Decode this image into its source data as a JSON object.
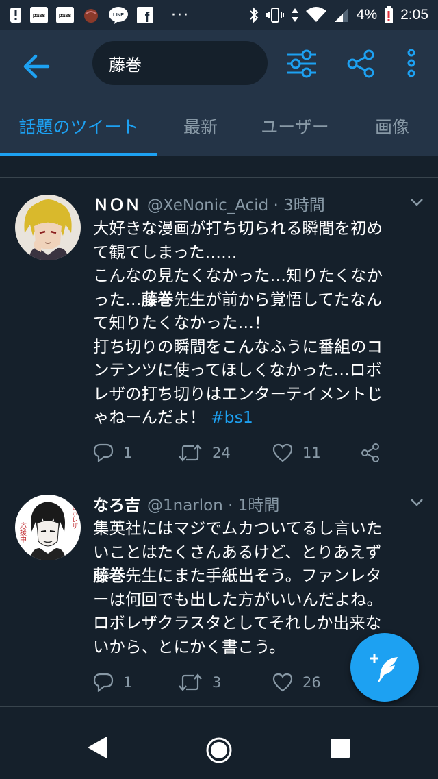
{
  "status_bar": {
    "pass_label": "pass",
    "line_label": "LINE",
    "facebook_label": "f",
    "overflow_dots": "···",
    "battery_percent": "4%",
    "time": "2:05"
  },
  "app_bar": {
    "search_query": "藤巻"
  },
  "tabs": [
    {
      "label": "話題のツイート",
      "active": true
    },
    {
      "label": "最新",
      "active": false
    },
    {
      "label": "ユーザー",
      "active": false
    },
    {
      "label": "画像",
      "active": false
    }
  ],
  "tweets": [
    {
      "name": "ＮＯＮ",
      "handle": "@XeNonic_Acid · 3時間",
      "text_lines": [
        "大好きな漫画が打ち切られる瞬間を初め",
        "て観てしまった……",
        "こんなの見たくなかった…知りたくなか",
        "った…",
        "藤巻",
        "先生が前から覚悟してたなん",
        "て知りたくなかった…！",
        "打ち切りの瞬間をこんなふうに番組のコ",
        "ンテンツに使ってほしくなかった…ロボ",
        "レザの打ち切りはエンターテイメントじ",
        "ゃねーんだよ！ ",
        "#bs1"
      ],
      "replies": "1",
      "retweets": "24",
      "likes": "11"
    },
    {
      "name": "なろ吉",
      "handle": "@1narlon · 1時間",
      "text_lines": [
        "集英社にはマジでムカついてるし言いた",
        "いことはたくさんあるけど、とりあえず",
        "藤巻",
        "先生にまた手紙出そう。ファンレタ",
        "ーは何回でも出した方がいいんだよね。",
        "ロボレザクラスタとしてそれしか出来な",
        "いから、とにかく書こう。"
      ],
      "replies": "1",
      "retweets": "3",
      "likes": "26"
    }
  ],
  "avatar_2_badge_left": "応援中",
  "avatar_2_badge_right": "ロボレザ",
  "colors": {
    "background": "#15202b",
    "header": "#243447",
    "accent": "#1da1f2",
    "secondary_text": "#8899a6",
    "divider": "#38444d"
  },
  "icons": [
    "alert-icon",
    "pass-icon",
    "pass-icon",
    "chestnut-icon",
    "line-icon",
    "facebook-icon",
    "bluetooth-icon",
    "vibrate-icon",
    "data-arrows-icon",
    "wifi-icon",
    "signal-icon",
    "battery-low-icon",
    "back-arrow-icon",
    "filter-sliders-icon",
    "share-icon",
    "more-vertical-icon",
    "chevron-down-icon",
    "reply-icon",
    "retweet-icon",
    "like-heart-icon",
    "compose-feather-icon",
    "nav-back-icon",
    "nav-home-icon",
    "nav-recents-icon"
  ]
}
